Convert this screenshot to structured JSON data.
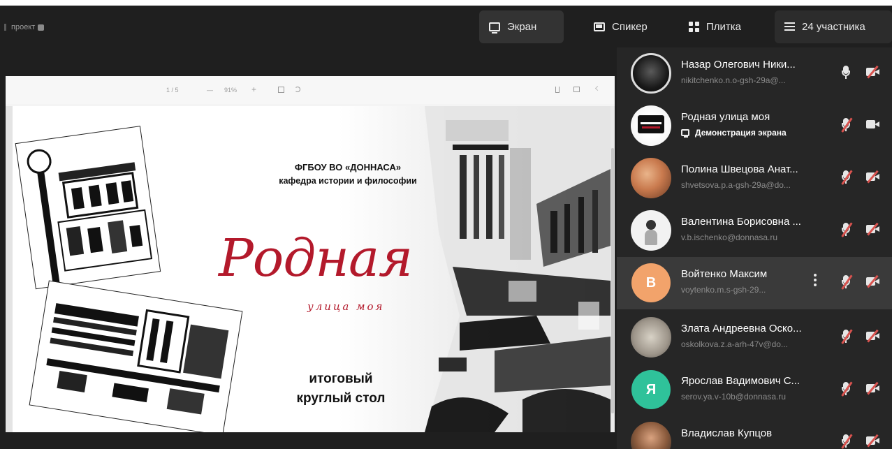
{
  "header": {
    "project_label": "проект",
    "views": [
      {
        "label": "Экран",
        "icon": "screen-icon",
        "active": true
      },
      {
        "label": "Спикер",
        "icon": "speaker-icon",
        "active": false
      },
      {
        "label": "Плитка",
        "icon": "tile-icon",
        "active": false
      },
      {
        "label": "24 участника",
        "icon": "list-icon",
        "active": false
      }
    ]
  },
  "pdf_toolbar": {
    "page": "1 / 5",
    "zoom": "91%",
    "minus": "—",
    "plus": "+"
  },
  "slide": {
    "institution": "ФГБОУ ВО «ДОННАСА»",
    "department": "кафедра истории и философии",
    "title": "Родная",
    "subtitle": "улица моя",
    "event_line1": "итоговый",
    "event_line2": "круглый стол"
  },
  "participants": [
    {
      "name": "Назар Олегович Ники...",
      "sub": "nikitchenko.n.o-gsh-29a@...",
      "avatar": "photo",
      "mic_on": true,
      "cam_on": false
    },
    {
      "name": "Родная улица моя",
      "sub": "Демонстрация экрана",
      "avatar": "photo",
      "mic_on": false,
      "cam_on": true,
      "sharing": true
    },
    {
      "name": "Полина Швецова Анат...",
      "sub": "shvetsova.p.a-gsh-29a@do...",
      "avatar": "photo",
      "mic_on": false,
      "cam_on": false
    },
    {
      "name": "Валентина Борисовна ...",
      "sub": "v.b.ischenko@donnasa.ru",
      "avatar": "photo",
      "mic_on": false,
      "cam_on": false
    },
    {
      "name": "Войтенко Максим",
      "sub": "voytenko.m.s-gsh-29...",
      "avatar": "letter",
      "letter": "В",
      "color": "#f2a36b",
      "mic_on": false,
      "cam_on": false,
      "highlighted": true
    },
    {
      "name": "Злата Андреевна Оско...",
      "sub": "oskolkova.z.a-arh-47v@do...",
      "avatar": "photo",
      "mic_on": false,
      "cam_on": false
    },
    {
      "name": "Ярослав Вадимович С...",
      "sub": "serov.ya.v-10b@donnasa.ru",
      "avatar": "letter",
      "letter": "Я",
      "color": "#2fc29a",
      "mic_on": false,
      "cam_on": false
    },
    {
      "name": "Владислав Купцов",
      "sub": "",
      "avatar": "photo",
      "mic_on": false,
      "cam_on": false
    }
  ],
  "colors": {
    "background": "#1f1f1f",
    "panel": "#262626",
    "accent_red": "#b3192b",
    "muted_red": "#d9534f"
  }
}
